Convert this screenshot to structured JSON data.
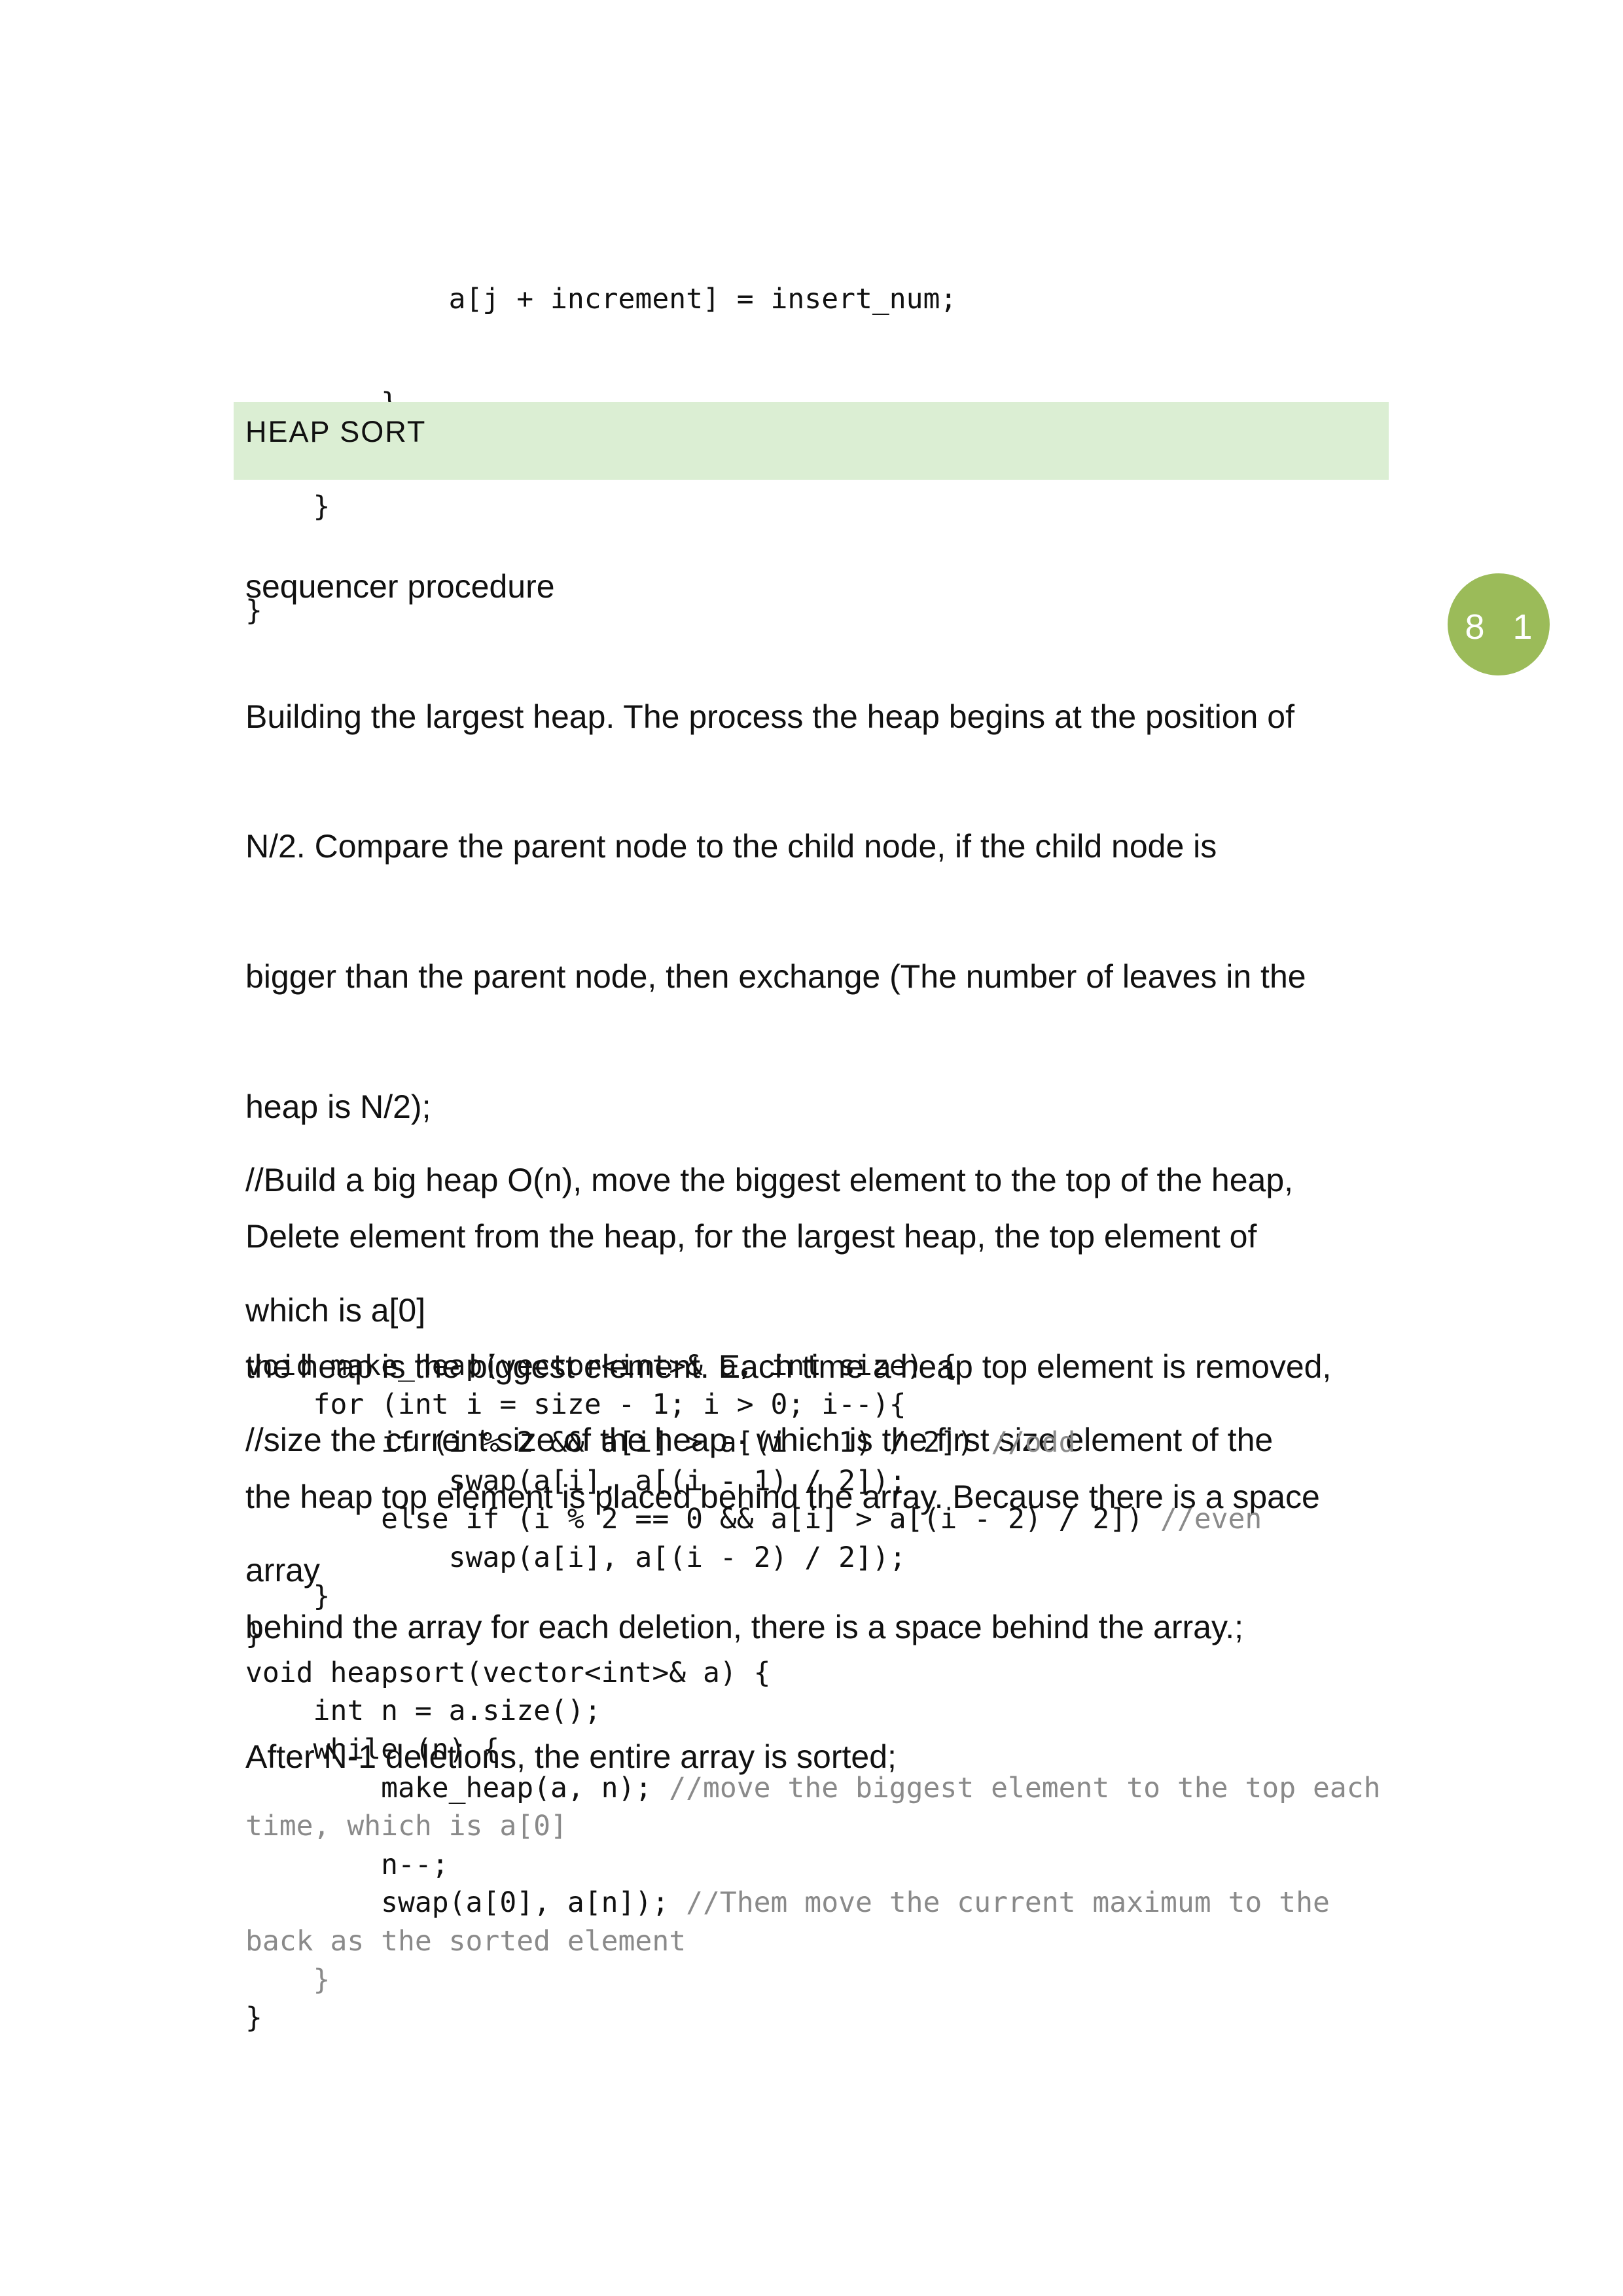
{
  "page_number": "8 1",
  "colors": {
    "heading_band": "#dbeed3",
    "badge": "#9bbb59",
    "comment": "#8a8a8a"
  },
  "code_top": [
    "            a[j + increment] = insert_num;",
    "        }",
    "    }",
    "}"
  ],
  "section_heading": "HEAP SORT",
  "description": [
    "sequencer procedure",
    "Building the largest heap. The process the heap begins at the position of",
    "N/2. Compare the parent node to the child node, if the child node is",
    "bigger than the parent node, then exchange (The number of leaves in the",
    "heap is N/2);",
    "Delete element from the heap, for the largest heap, the top element of",
    "the heap is the biggest element. Each time a heap top element is removed,",
    "the heap top element is placed behind the array. Because there is a space",
    "behind the array for each deletion, there is a space behind the array.;",
    "After N-1 deletions, the entire array is sorted;"
  ],
  "notes": [
    "//Build a big heap O(n), move the biggest element to the top of the heap,",
    "which is a[0]",
    "//size the current size of the heap · which is the first size element of the",
    "array"
  ],
  "code_main": [
    {
      "code": "void make_heap(vector<int>& a, int size) {",
      "comment": ""
    },
    {
      "code": "    for (int i = size - 1; i > 0; i--){",
      "comment": ""
    },
    {
      "code": "        if (i % 2 && a[i] > a[(i - 1) / 2]) ",
      "comment": "//odd"
    },
    {
      "code": "            swap(a[i], a[(i - 1) / 2]);",
      "comment": ""
    },
    {
      "code": "        else if (i % 2 == 0 && a[i] > a[(i - 2) / 2]) ",
      "comment": "//even"
    },
    {
      "code": "            swap(a[i], a[(i - 2) / 2]);",
      "comment": ""
    },
    {
      "code": "    }",
      "comment": ""
    },
    {
      "code": "}",
      "comment": ""
    },
    {
      "code": "void heapsort(vector<int>& a) {",
      "comment": ""
    },
    {
      "code": "    int n = a.size();",
      "comment": ""
    },
    {
      "code": "    while (n) {",
      "comment": ""
    },
    {
      "code": "        make_heap(a, n); ",
      "comment": "//move the biggest element to the top each"
    },
    {
      "code": "",
      "comment": "time, which is a[0]"
    },
    {
      "code": "        n--;",
      "comment": ""
    },
    {
      "code": "        swap(a[0], a[n]); ",
      "comment": "//Them move the current maximum to the"
    },
    {
      "code": "",
      "comment": "back as the sorted element"
    },
    {
      "code": "",
      "comment": "    }"
    },
    {
      "code": "}",
      "comment": ""
    }
  ]
}
